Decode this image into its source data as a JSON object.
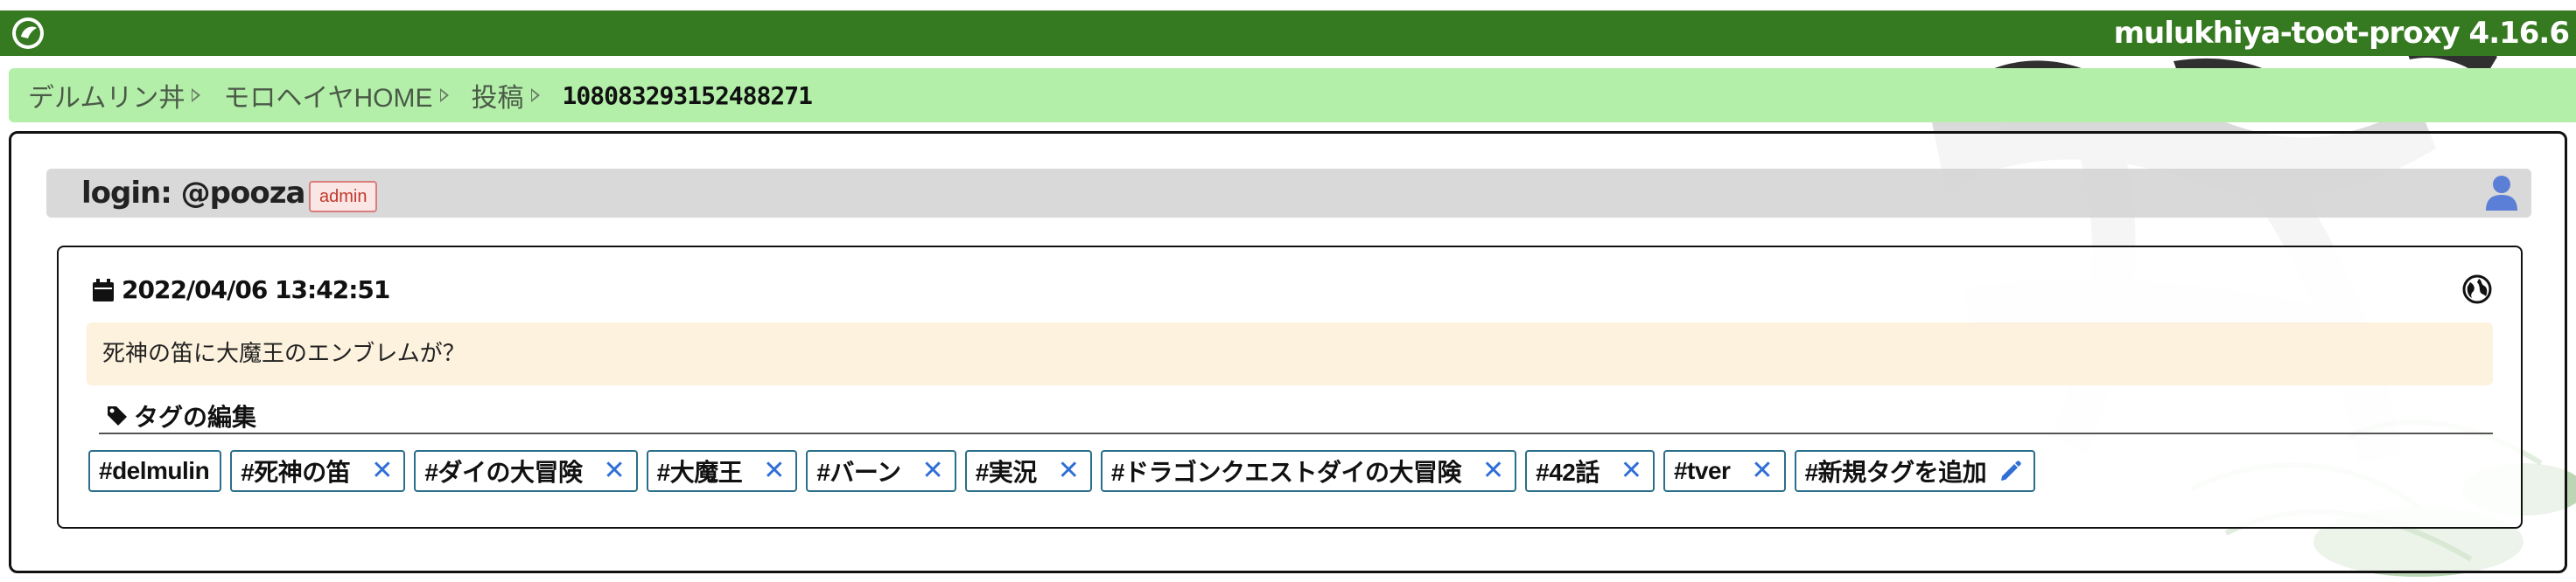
{
  "app": {
    "title": "mulukhiya-toot-proxy 4.16.6"
  },
  "breadcrumb": {
    "items": [
      "デルムリン丼",
      "モロヘイヤHOME",
      "投稿"
    ],
    "current": "108083293152488271"
  },
  "login": {
    "text": "login: @pooza",
    "badge": "admin"
  },
  "toot": {
    "date": "2022/04/06 13:42:51",
    "body": "死神の笛に大魔王のエンブレムが？"
  },
  "tags": {
    "section_title": "タグの編集",
    "items": [
      {
        "label": "#delmulin",
        "removable": false
      },
      {
        "label": "#死神の笛",
        "removable": true
      },
      {
        "label": "#ダイの大冒険",
        "removable": true
      },
      {
        "label": "#大魔王",
        "removable": true
      },
      {
        "label": "#バーン",
        "removable": true
      },
      {
        "label": "#実況",
        "removable": true
      },
      {
        "label": "#ドラゴンクエストダイの大冒険",
        "removable": true
      },
      {
        "label": "#42話",
        "removable": true
      },
      {
        "label": "#tver",
        "removable": true
      }
    ],
    "add_label": "#新規タグを追加",
    "remove_glyph": "✕"
  },
  "colors": {
    "top_bar": "#357a21",
    "breadcrumb_bg": "#b3efa9",
    "toot_body_bg": "#fdf2de",
    "tag_border": "#2a6f8a",
    "accent_blue": "#2f6fd6",
    "admin_badge": "#c0392b"
  },
  "icons": {
    "logo": "logo-icon",
    "user": "user-icon",
    "calendar": "calendar-icon",
    "visibility": "globe-icon",
    "tag": "tag-icon",
    "edit": "pencil-icon"
  }
}
